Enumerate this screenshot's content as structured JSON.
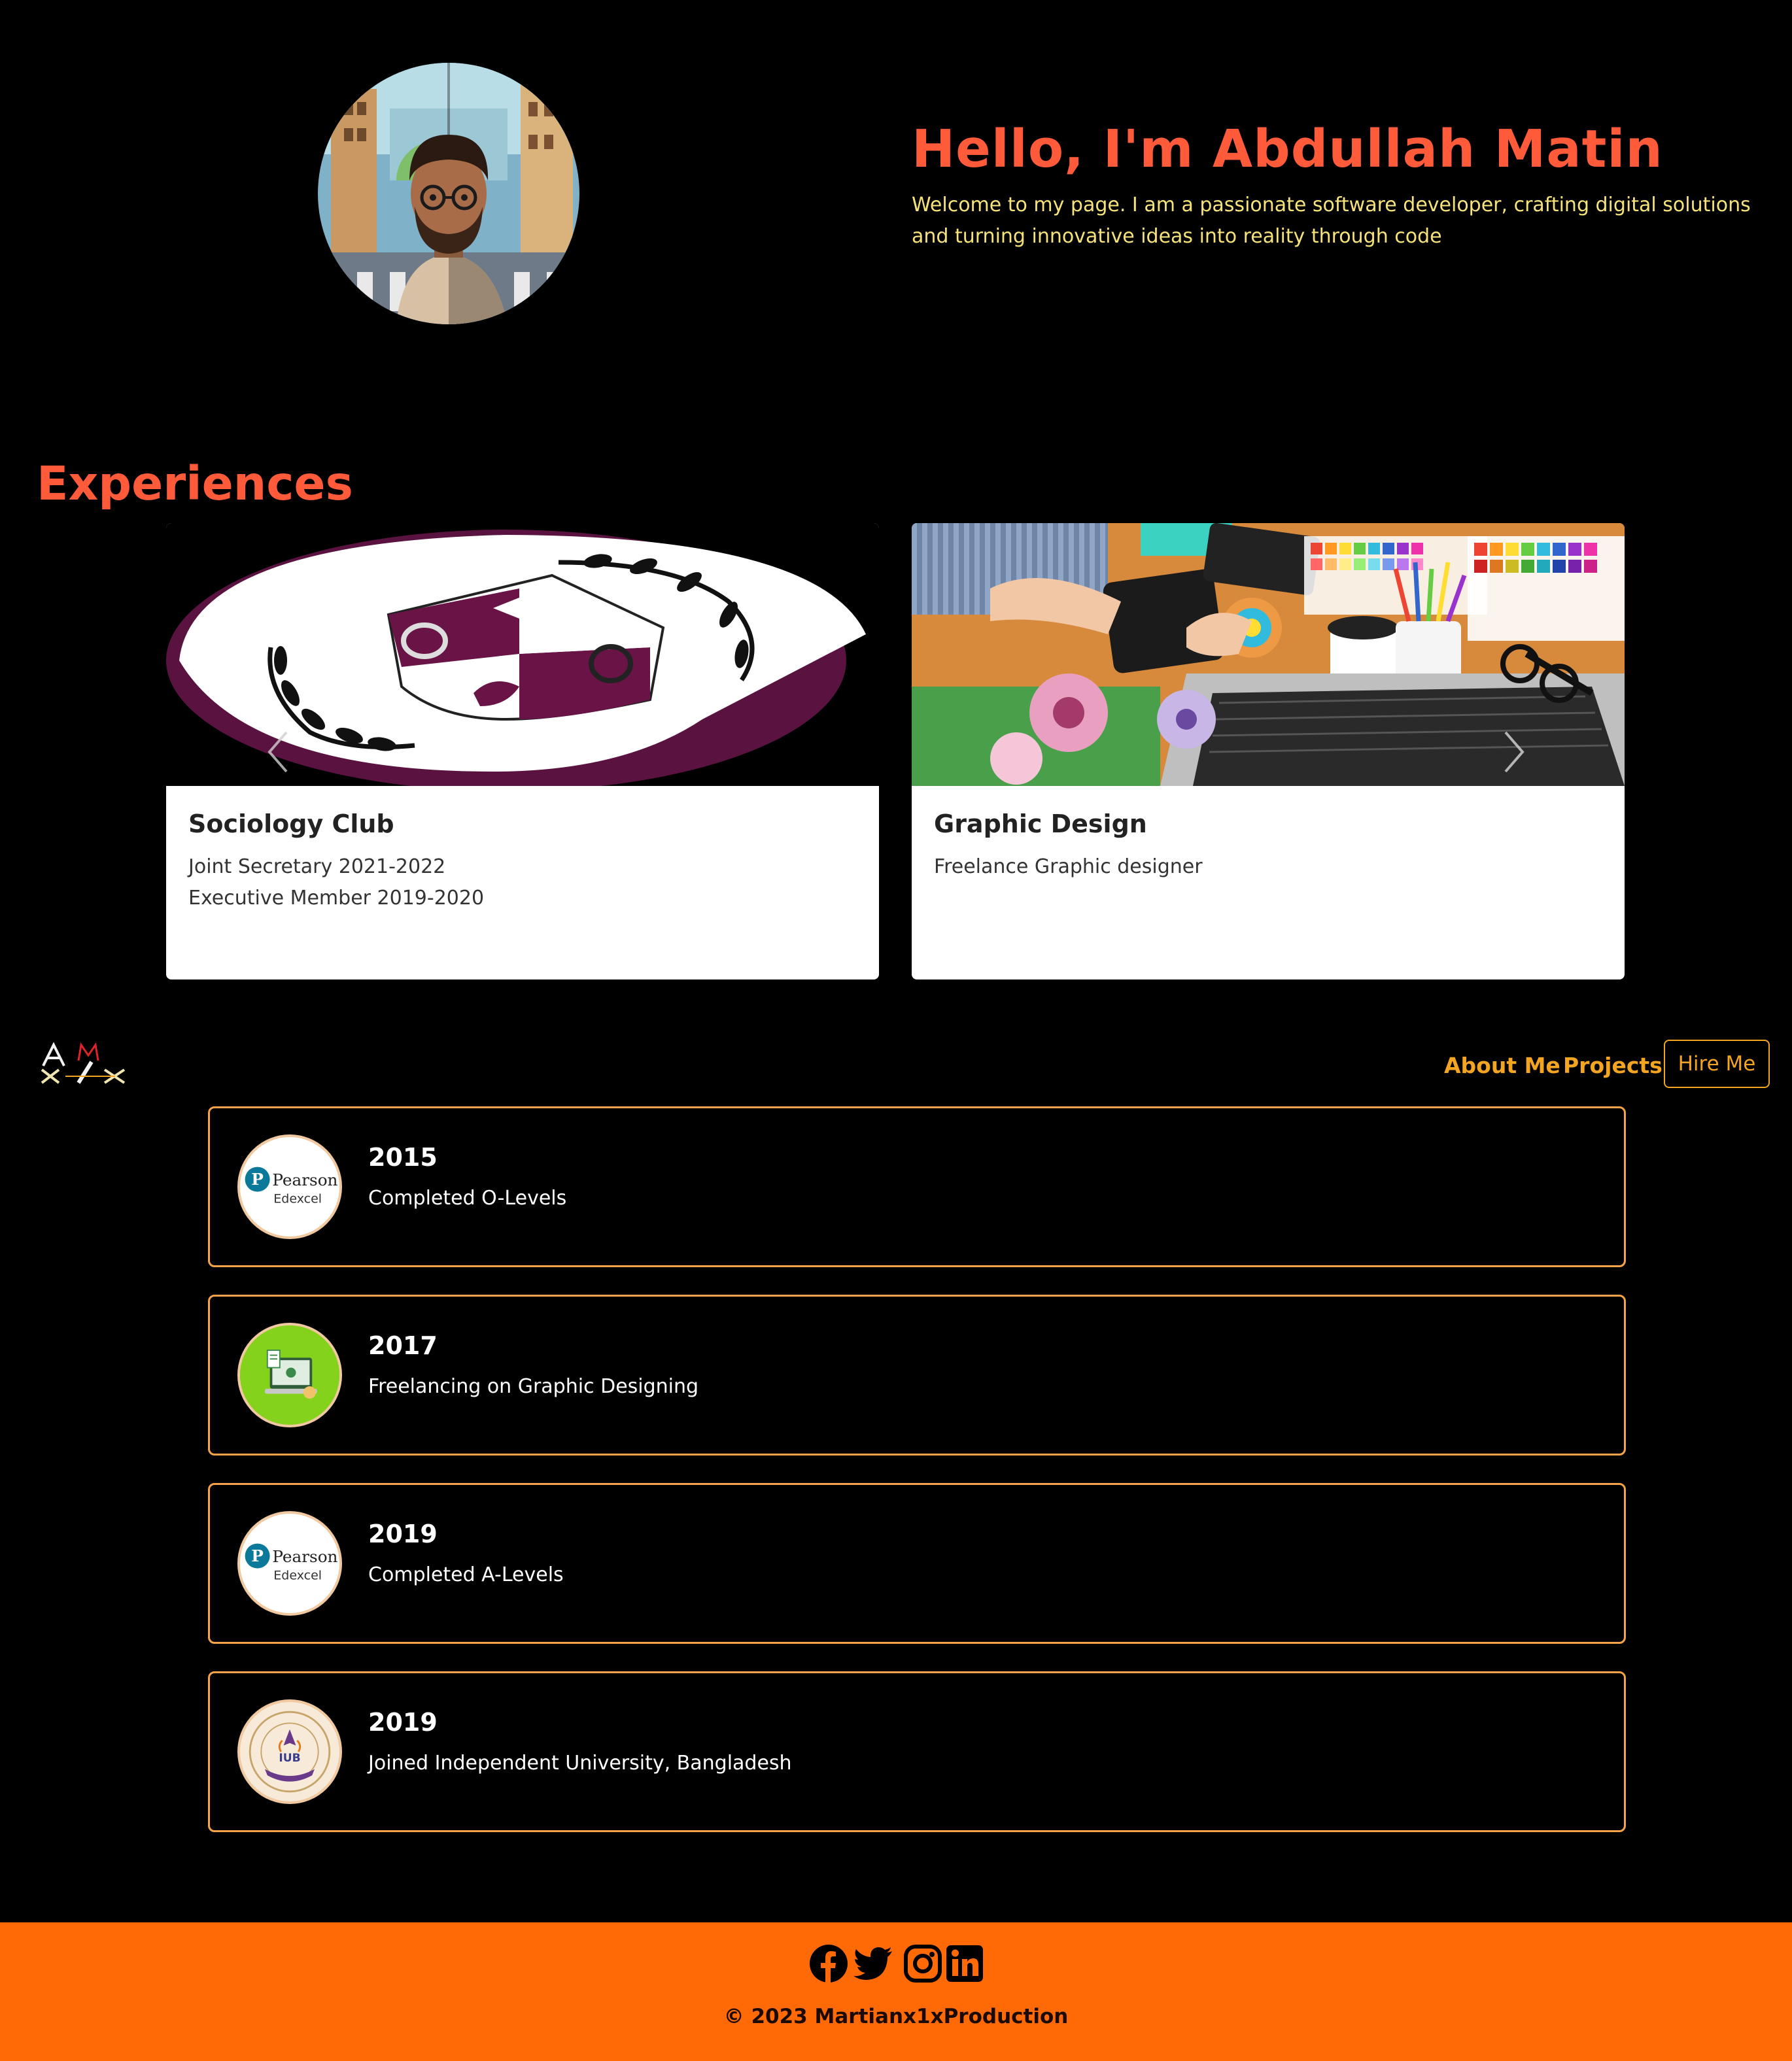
{
  "hero": {
    "title": "Hello, I'm Abdullah Matin",
    "subtitle": "Welcome to my page. I am a passionate software developer, crafting digital solutions and turning innovative ideas into reality through code",
    "avatar_icon": "avatar-portrait"
  },
  "experiences": {
    "title": "Experiences",
    "cards": [
      {
        "title": "Sociology Club",
        "lines": [
          "Joint Secretary 2021-2022",
          "Executive Member 2019-2020"
        ],
        "image_icon": "sociology-club-logo"
      },
      {
        "title": "Graphic Design",
        "lines": [
          "Freelance Graphic designer"
        ],
        "image_icon": "graphic-design-desk"
      }
    ]
  },
  "nav": {
    "logo_icon": "amx1x-logo",
    "about": "About Me",
    "projects": "Projects",
    "hire": "Hire Me"
  },
  "timeline": [
    {
      "year": "2015",
      "text": "Completed O-Levels",
      "icon": "pearson-edexcel-logo"
    },
    {
      "year": "2017",
      "text": "Freelancing on Graphic Designing",
      "icon": "freelancing-icon"
    },
    {
      "year": "2019",
      "text": "Completed A-Levels",
      "icon": "pearson-edexcel-logo"
    },
    {
      "year": "2019",
      "text": "Joined Independent University, Bangladesh",
      "icon": "iub-logo"
    }
  ],
  "logo_text": {
    "pearson": "Pearson",
    "edexcel": "Edexcel",
    "iub": "IUB"
  },
  "footer": {
    "copyright": "© 2023 Martianx1xProduction",
    "social": [
      "facebook-icon",
      "twitter-icon",
      "instagram-icon",
      "linkedin-icon"
    ]
  },
  "colors": {
    "background": "#000000",
    "accent_red": "#ff5b3a",
    "accent_gold": "#f3a521",
    "subtitle_yellow": "#f6e27a",
    "footer_orange": "#ff6a06"
  }
}
